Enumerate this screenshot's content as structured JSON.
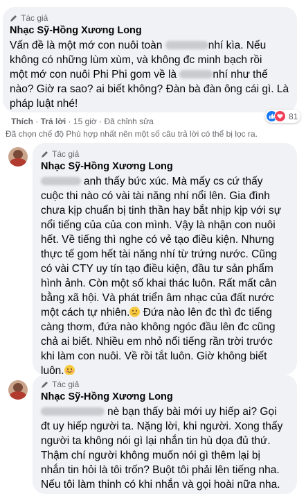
{
  "comments": [
    {
      "badge": "Tác giả",
      "author": "Nhạc Sỹ-Hồng Xương Long",
      "lines": [
        [
          "Vấn đề là một mớ con nuôi toàn ",
          "",
          "nhí kìa. Nếu"
        ],
        [
          "không có những lùm xùm, và không đc minh bạch rồi"
        ],
        [
          "một mớ con nuôi Phi Phi gom về là ",
          "",
          "nhí như thế"
        ],
        [
          "nào? Giờ ra sao? ai biết không? Đàn bà đàn ông cái gì. Là"
        ],
        [
          "pháp luật nhé!"
        ]
      ],
      "actions": {
        "like": "Thích",
        "reply": "Trả lời",
        "time": "15 giờ",
        "edited": "Đã chỉnh sửa"
      },
      "reaction_count": "81"
    },
    {
      "badge": "Tác giả",
      "author": "Nhạc Sỹ-Hồng Xương Long",
      "lines": [
        [
          "",
          "anh thấy bức xúc. Mà mấy cs cứ thấy"
        ],
        [
          "cuộc thi nào có vài tài năng nhí nổi lên. Gia đình"
        ],
        [
          "chưa kịp chuẩn bị tinh thần hay bắt nhịp kịp với sự"
        ],
        [
          "nổi tiếng của của con mình. Vậy là nhận con nuôi"
        ],
        [
          "hết. Về tiếng thì nghe có vẻ tạo điều kiện. Nhưng"
        ],
        [
          "thực tế gom hết tài năng nhí từ trứng nước. Cũng"
        ],
        [
          "có vài CTY uy tín tạo điều kiện, đầu tư sản phẩm"
        ],
        [
          "hình ảnh. Còn một số khai thác luôn. Rất mất cân"
        ],
        [
          "bằng xã hội. Và phát triển âm nhạc của đất nước"
        ],
        [
          "một cách tự nhiên.",
          "SAD",
          " Đứa nào lên đc thì đc tiếng"
        ],
        [
          "càng thơm, đứa nào không ngóc đầu lên đc cũng"
        ],
        [
          "chả ai biết. Nhiều em nhỏ nổi tiếng rần trời trước"
        ],
        [
          "khi làm con nuôi. Về rồi tắt luôn. Giờ không biết"
        ],
        [
          "luôn.",
          "SMILE"
        ]
      ]
    },
    {
      "badge": "Tác giả",
      "author": "Nhạc Sỹ-Hồng Xương Long",
      "lines": [
        [
          "",
          "nè bạn thấy bài mới uy hiếp ai? Gọi"
        ],
        [
          "đt uy hiếp người ta. Nặng lời, khi người. Xong thấy"
        ],
        [
          "người ta không nói gì lại nhắn tin hù dọa đủ thứ."
        ],
        [
          "Thậm chí người không muốn nói gì thêm lại bị"
        ],
        [
          "nhắn tin hỏi là tôi trốn? Buột tôi phải lên tiếng nha."
        ],
        [
          "Nếu tôi làm thinh có khi nhắn và gọi hoài nữa nha."
        ]
      ]
    }
  ],
  "filter_note": "Đã chọn chế độ Phù hợp nhất nên một số câu trả lời có thể bị lọc ra.",
  "colors": {
    "bubble": "#f0f2f5",
    "secondary_text": "#65676b",
    "like_blue": "#1877f2",
    "love_red": "#f33e58"
  },
  "icons": {
    "badge": "pencil-icon",
    "reaction_like": "thumbs-up-icon",
    "reaction_love": "heart-icon"
  }
}
